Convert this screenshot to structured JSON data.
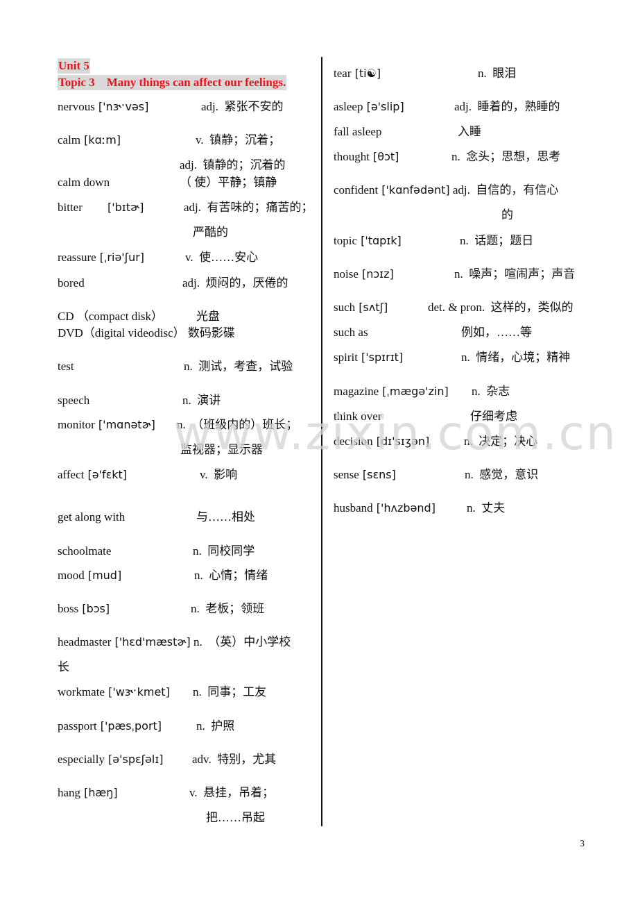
{
  "header": {
    "unit": "Unit 5",
    "topic": "Topic 3　Many things can affect our feelings."
  },
  "watermark": "www.zixin.com.cn",
  "page_number": "3",
  "left_column": [
    {
      "word": "nervous",
      "ipa": "['nɝˑvəs]",
      "pos": "adj.",
      "meaning": "紧张不安的"
    },
    {
      "word": "calm",
      "ipa": "[kɑːm]",
      "pos": "v.",
      "meaning": "镇静；沉着；"
    },
    {
      "word": "",
      "ipa": "",
      "pos": "adj.",
      "meaning": "镇静的；沉着的"
    },
    {
      "word": "calm down",
      "ipa": "",
      "pos": "",
      "meaning": "（ 使）平静；镇静"
    },
    {
      "word": "bitter",
      "ipa": "['bɪtɚ]",
      "pos": "adj.",
      "meaning": "有苦味的；痛苦的；"
    },
    {
      "word": "",
      "ipa": "",
      "pos": "",
      "meaning": "严酷的"
    },
    {
      "word": "reassure",
      "ipa": "[ˌriə'ʃur]",
      "pos": "v.",
      "meaning": "使……安心"
    },
    {
      "word": "bored",
      "ipa": "",
      "pos": "adj.",
      "meaning": "烦闷的，厌倦的"
    },
    {
      "word": "CD （compact disk）",
      "ipa": "",
      "pos": "",
      "meaning": "光盘"
    },
    {
      "word": "DVD（digital videodisc）",
      "ipa": "",
      "pos": "",
      "meaning": "数码影碟"
    },
    {
      "word": "test",
      "ipa": "",
      "pos": "n.",
      "meaning": "测试，考查，试验"
    },
    {
      "word": "speech",
      "ipa": "",
      "pos": "n.",
      "meaning": "演讲"
    },
    {
      "word": "monitor",
      "ipa": "['mɑnətɚ]",
      "pos": "n.",
      "meaning": "（班级内的）班长；"
    },
    {
      "word": "",
      "ipa": "",
      "pos": "",
      "meaning": "监视器；显示器"
    },
    {
      "word": "affect",
      "ipa": "[ə'fɛkt]",
      "pos": "v.",
      "meaning": "影响"
    },
    {
      "word": "get along with",
      "ipa": "",
      "pos": "",
      "meaning": "与……相处"
    },
    {
      "word": "schoolmate",
      "ipa": "",
      "pos": "n.",
      "meaning": "同校同学"
    },
    {
      "word": "mood",
      "ipa": "[mud]",
      "pos": "n.",
      "meaning": "心情；情绪"
    },
    {
      "word": "boss",
      "ipa": "[bɔs]",
      "pos": "n.",
      "meaning": "老板；领班"
    },
    {
      "word": "headmaster",
      "ipa": "['hɛd'mæstɚ]",
      "pos": "n.",
      "meaning": "（英）中小学校"
    },
    {
      "word": "",
      "ipa": "",
      "pos": "",
      "meaning": "长"
    },
    {
      "word": "workmate",
      "ipa": "['wɝˑkmet]",
      "pos": "n.",
      "meaning": "同事；工友"
    },
    {
      "word": "passport",
      "ipa": "['pæsˌport]",
      "pos": "n.",
      "meaning": "护照"
    },
    {
      "word": "especially",
      "ipa": "[ə'spɛʃəlɪ]",
      "pos": "adv.",
      "meaning": "特别，尤其"
    },
    {
      "word": "hang",
      "ipa": "[hæŋ]",
      "pos": "v.",
      "meaning": "悬挂，吊着；"
    },
    {
      "word": "",
      "ipa": "",
      "pos": "",
      "meaning": "把……吊起"
    }
  ],
  "right_column": [
    {
      "word": "tear",
      "ipa": "[ti☯]",
      "pos": "n.",
      "meaning": "眼泪"
    },
    {
      "word": "asleep",
      "ipa": "[ə'slip]",
      "pos": "adj.",
      "meaning": "睡着的，熟睡的"
    },
    {
      "word": "fall asleep",
      "ipa": "",
      "pos": "",
      "meaning": "入睡"
    },
    {
      "word": "thought",
      "ipa": "[θɔt]",
      "pos": "n.",
      "meaning": "念头；思想，思考"
    },
    {
      "word": "confident",
      "ipa": "['kɑnfədənt]",
      "pos": "adj.",
      "meaning": "自信的，有信心"
    },
    {
      "word": "",
      "ipa": "",
      "pos": "",
      "meaning": "的"
    },
    {
      "word": "topic",
      "ipa": "['tɑpɪk]",
      "pos": "n.",
      "meaning": "话题；题日"
    },
    {
      "word": "noise",
      "ipa": "[nɔɪz]",
      "pos": "n.",
      "meaning": "噪声；喧闹声；声音"
    },
    {
      "word": "such",
      "ipa": "[sʌtʃ]",
      "pos": "det. & pron.",
      "meaning": "这样的，类似的"
    },
    {
      "word": "such as",
      "ipa": "",
      "pos": "",
      "meaning": "例如，……等"
    },
    {
      "word": "spirit",
      "ipa": "['spɪrɪt]",
      "pos": "n.",
      "meaning": "情绪，心境；精神"
    },
    {
      "word": "magazine",
      "ipa": "[ˌmægə'zin]",
      "pos": "n.",
      "meaning": "杂志"
    },
    {
      "word": "think over",
      "ipa": "",
      "pos": "",
      "meaning": "仔细考虑"
    },
    {
      "word": "decision",
      "ipa": "[dɪ'sɪʒən]",
      "pos": "n.",
      "meaning": "决定；决心"
    },
    {
      "word": "sense",
      "ipa": "[sɛns]",
      "pos": "n.",
      "meaning": "感觉，意识"
    },
    {
      "word": "husband",
      "ipa": "['hʌzbənd]",
      "pos": "n.",
      "meaning": "丈夫"
    }
  ]
}
